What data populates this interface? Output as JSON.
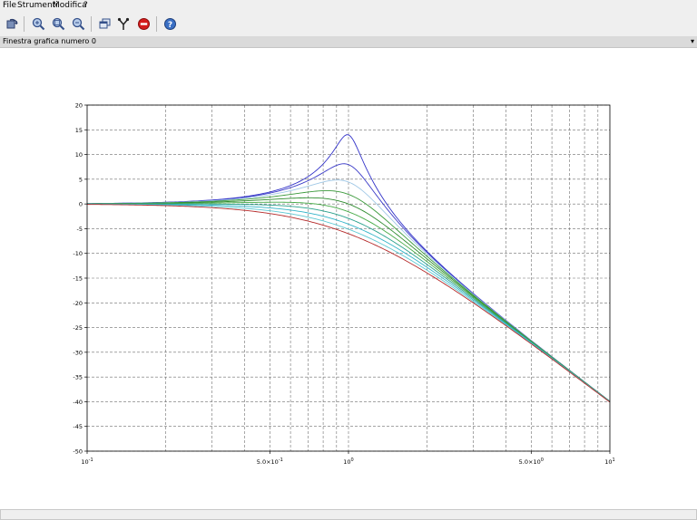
{
  "menu": {
    "file": "File",
    "tools": "Strumenti",
    "edit": "Modifica",
    "help": "?"
  },
  "toolbar": [
    {
      "name": "rotate-button",
      "icon": "rotate-3d-icon"
    },
    {
      "name": "zoom-in-button",
      "icon": "zoom-in-icon"
    },
    {
      "name": "zoom-area-button",
      "icon": "zoom-area-icon"
    },
    {
      "name": "zoom-reset-button",
      "icon": "zoom-reset-icon"
    },
    {
      "name": "new-window-button",
      "icon": "windows-icon"
    },
    {
      "name": "datatip-button",
      "icon": "datatip-icon"
    },
    {
      "name": "stop-button",
      "icon": "stop-icon"
    },
    {
      "name": "help-button",
      "icon": "help-icon"
    }
  ],
  "window": {
    "title": "Finestra grafica numero 0",
    "pin": "▾"
  },
  "colors": {
    "grid": "#6e6e6e",
    "axis": "#000000"
  },
  "chart_data": {
    "type": "line",
    "x_scale": "log",
    "xlim": [
      0.1,
      10
    ],
    "ylim": [
      -50,
      20
    ],
    "yticks": [
      20,
      15,
      10,
      5,
      0,
      -5,
      -10,
      -15,
      -20,
      -25,
      -30,
      -35,
      -40,
      -45,
      -50
    ],
    "xtick_labels": [
      {
        "x": 0.1,
        "base": "10",
        "exp": "-1"
      },
      {
        "x": 0.5,
        "base": "5.0×10",
        "exp": "-1"
      },
      {
        "x": 1,
        "base": "10",
        "exp": "0"
      },
      {
        "x": 5,
        "base": "5.0×10",
        "exp": "0"
      },
      {
        "x": 10,
        "base": "10",
        "exp": "1"
      }
    ],
    "grid": true,
    "model": "magnitude_db of 1/(1 - w^2 + 2j*zeta*w)",
    "series": [
      {
        "zeta": 0.1,
        "color": "#3232c8"
      },
      {
        "zeta": 0.2,
        "color": "#3c3cc8"
      },
      {
        "zeta": 0.3,
        "color": "#a0c8e6"
      },
      {
        "zeta": 0.4,
        "color": "#3c9a3c"
      },
      {
        "zeta": 0.5,
        "color": "#2e8b2e"
      },
      {
        "zeta": 0.6,
        "color": "#46aa46"
      },
      {
        "zeta": 0.7,
        "color": "#28a08c"
      },
      {
        "zeta": 0.8,
        "color": "#32b4c8"
      },
      {
        "zeta": 0.9,
        "color": "#5cc8d2"
      },
      {
        "zeta": 1.0,
        "color": "#b42828"
      }
    ]
  }
}
